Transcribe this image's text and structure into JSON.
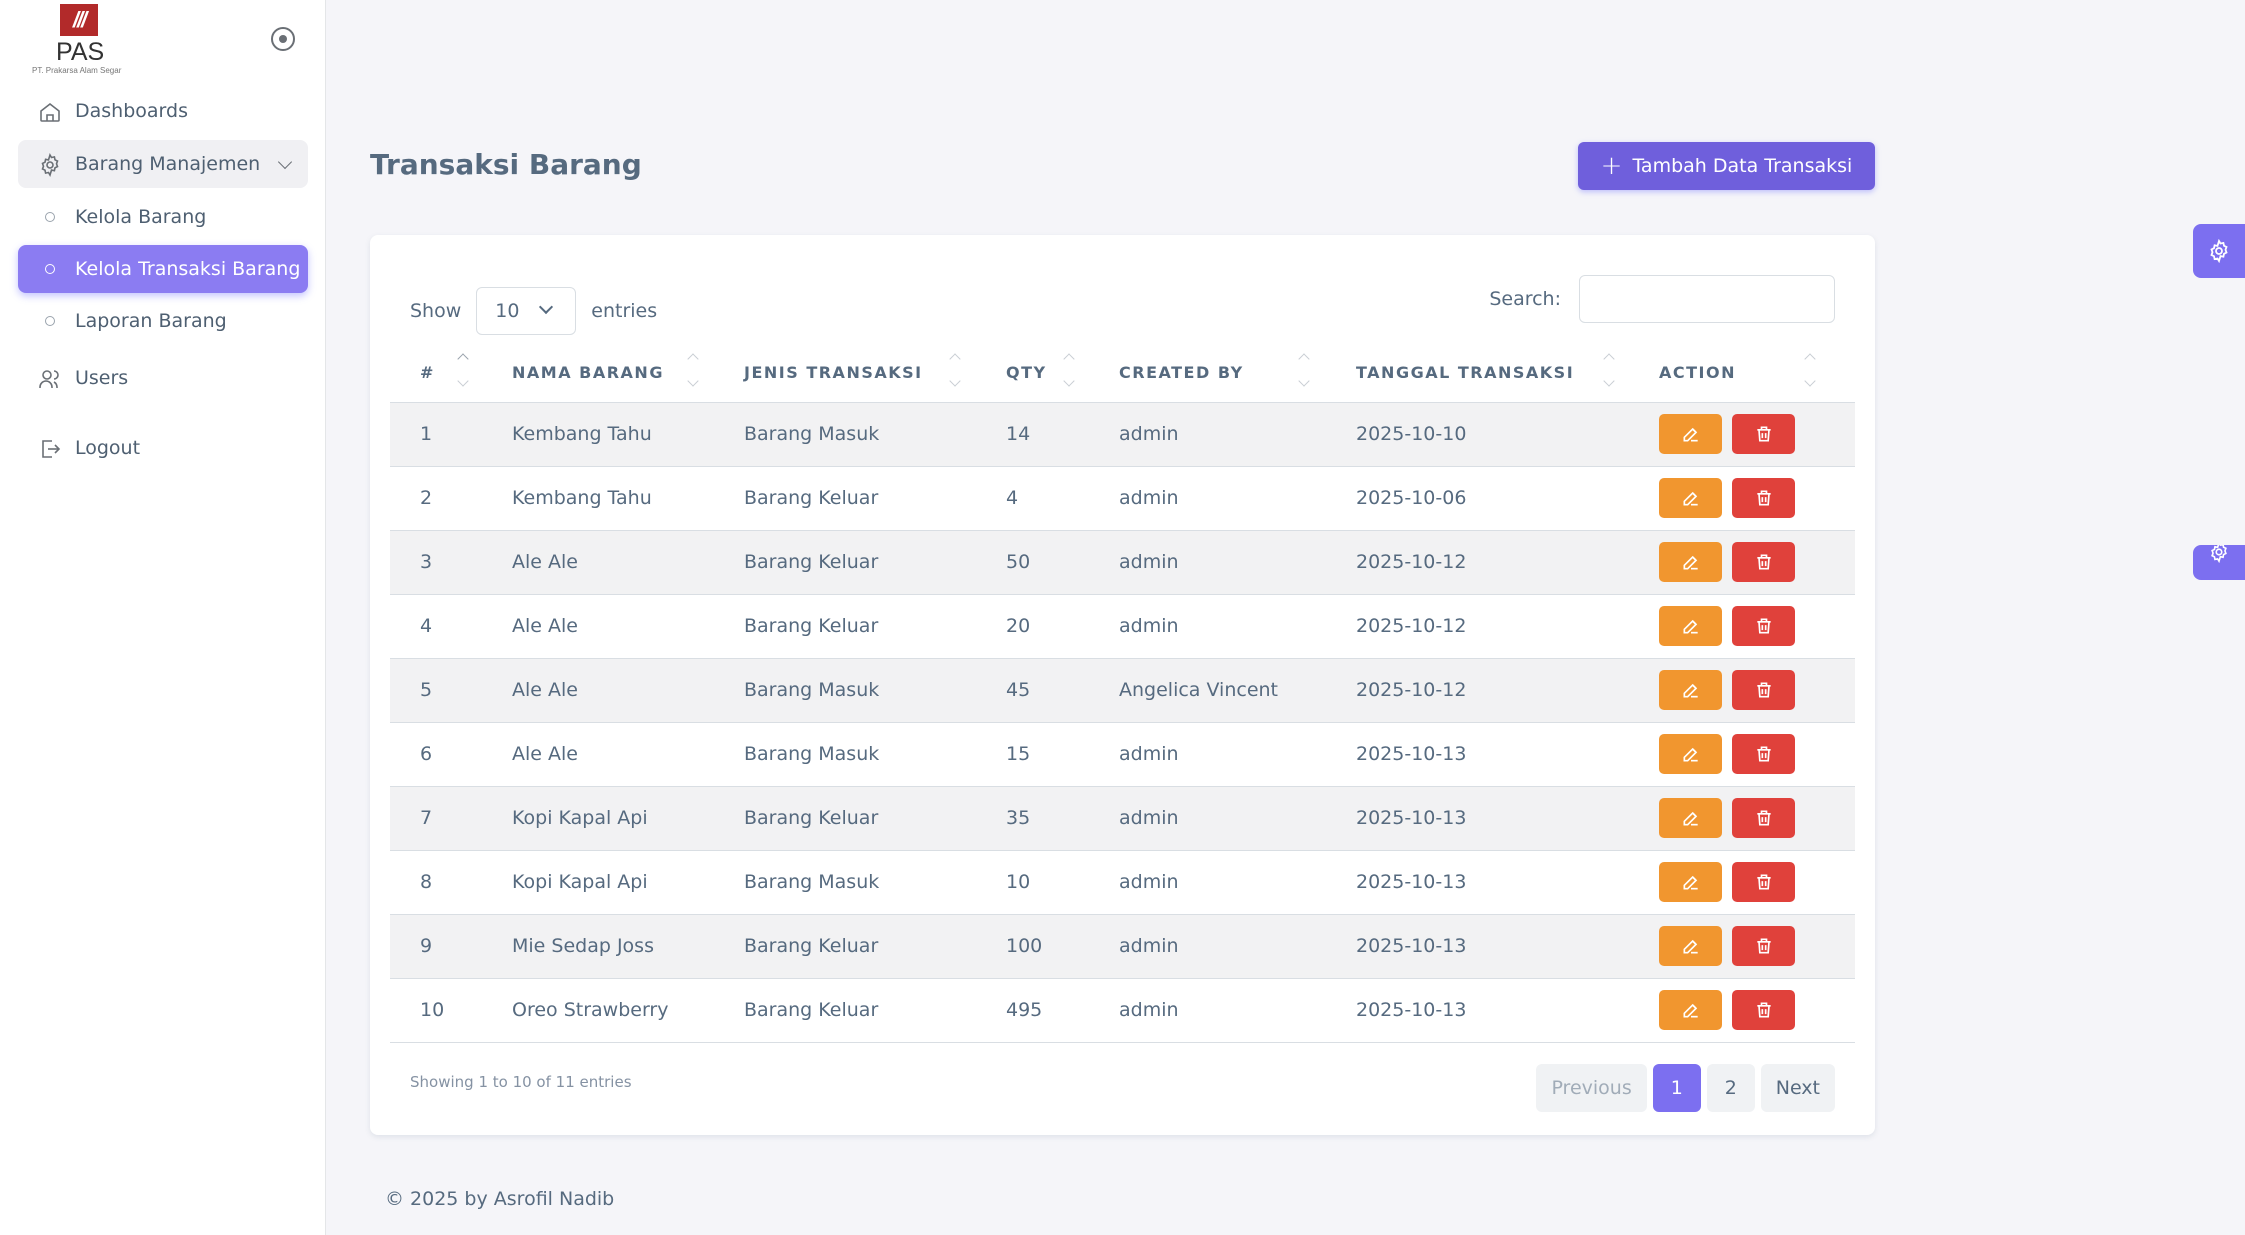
{
  "logo": {
    "mark": "///",
    "text": "PAS",
    "subtitle": "PT. Prakarsa Alam Segar"
  },
  "sidebar": {
    "items": [
      {
        "label": "Dashboards",
        "icon": "home-icon"
      },
      {
        "label": "Barang Manajemen",
        "icon": "gear-icon",
        "expanded": true
      },
      {
        "label": "Kelola Barang",
        "icon": "circle-icon"
      },
      {
        "label": "Kelola Transaksi Barang",
        "icon": "circle-icon",
        "active": true
      },
      {
        "label": "Laporan Barang",
        "icon": "circle-icon"
      },
      {
        "label": "Users",
        "icon": "users-icon"
      },
      {
        "label": "Logout",
        "icon": "logout-icon"
      }
    ]
  },
  "page": {
    "title": "Transaksi Barang",
    "add_button": "Tambah Data Transaksi"
  },
  "table_controls": {
    "show_label": "Show",
    "entries_value": "10",
    "entries_label": "entries",
    "search_label": "Search:",
    "search_value": ""
  },
  "table": {
    "columns": [
      "#",
      "NAMA BARANG",
      "JENIS TRANSAKSI",
      "QTY",
      "CREATED BY",
      "TANGGAL TRANSAKSI",
      "ACTION"
    ],
    "rows": [
      [
        "1",
        "Kembang Tahu",
        "Barang Masuk",
        "14",
        "admin",
        "2025-10-10"
      ],
      [
        "2",
        "Kembang Tahu",
        "Barang Keluar",
        "4",
        "admin",
        "2025-10-06"
      ],
      [
        "3",
        "Ale Ale",
        "Barang Keluar",
        "50",
        "admin",
        "2025-10-12"
      ],
      [
        "4",
        "Ale Ale",
        "Barang Keluar",
        "20",
        "admin",
        "2025-10-12"
      ],
      [
        "5",
        "Ale Ale",
        "Barang Masuk",
        "45",
        "Angelica Vincent",
        "2025-10-12"
      ],
      [
        "6",
        "Ale Ale",
        "Barang Masuk",
        "15",
        "admin",
        "2025-10-13"
      ],
      [
        "7",
        "Kopi Kapal Api",
        "Barang Keluar",
        "35",
        "admin",
        "2025-10-13"
      ],
      [
        "8",
        "Kopi Kapal Api",
        "Barang Masuk",
        "10",
        "admin",
        "2025-10-13"
      ],
      [
        "9",
        "Mie Sedap Joss",
        "Barang Keluar",
        "100",
        "admin",
        "2025-10-13"
      ],
      [
        "10",
        "Oreo Strawberry",
        "Barang Keluar",
        "495",
        "admin",
        "2025-10-13"
      ]
    ]
  },
  "pagination": {
    "info": "Showing 1 to 10 of 11 entries",
    "previous": "Previous",
    "pages": [
      "1",
      "2"
    ],
    "current": "1",
    "next": "Next"
  },
  "footer": {
    "text": "© 2025 by Asrofil Nadib"
  },
  "colors": {
    "primary": "#7c6ff0",
    "edit": "#f1962f",
    "delete": "#e0413b"
  }
}
